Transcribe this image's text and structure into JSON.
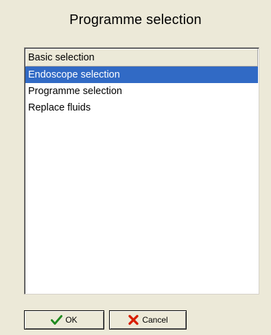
{
  "dialog": {
    "title": "Programme selection"
  },
  "list": {
    "header": "Basic selection",
    "items": [
      {
        "label": "Endoscope selection",
        "selected": true
      },
      {
        "label": "Programme selection",
        "selected": false
      },
      {
        "label": "Replace fluids",
        "selected": false
      }
    ]
  },
  "buttons": {
    "ok_label": "OK",
    "ok_icon": "checkmark-icon",
    "cancel_label": "Cancel",
    "cancel_icon": "cross-icon"
  },
  "colors": {
    "background": "#ece9d8",
    "selection": "#316ac5",
    "ok_icon": "#1f8a1f",
    "cancel_icon": "#d81e05"
  }
}
